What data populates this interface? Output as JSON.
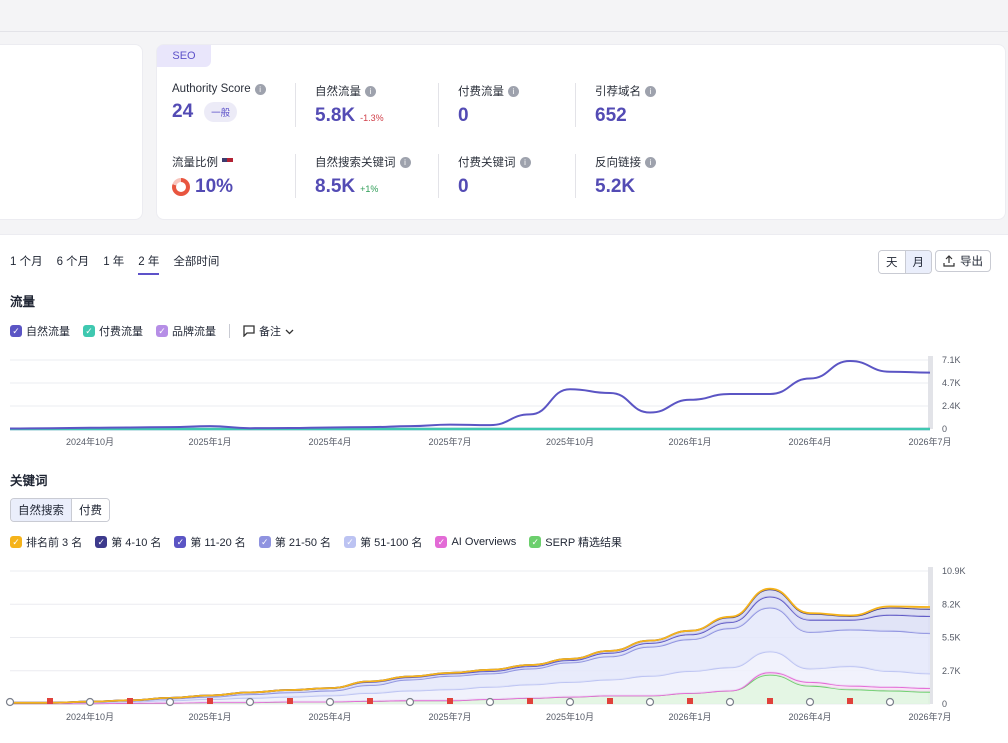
{
  "seo": {
    "tag": "SEO",
    "authority_label": "Authority Score",
    "authority_value": "24",
    "authority_badge": "一般",
    "organic_traffic_label": "自然流量",
    "organic_traffic_value": "5.8K",
    "organic_traffic_change": "-1.3%",
    "paid_traffic_label": "付费流量",
    "paid_traffic_value": "0",
    "ref_domains_label": "引荐域名",
    "ref_domains_value": "652",
    "traffic_share_label": "流量比例",
    "traffic_share_value": "10%",
    "organic_kw_label": "自然搜索关键词",
    "organic_kw_value": "8.5K",
    "organic_kw_change": "+1%",
    "paid_kw_label": "付费关键词",
    "paid_kw_value": "0",
    "backlinks_label": "反向链接",
    "backlinks_value": "5.2K"
  },
  "periods": [
    "1 个月",
    "6 个月",
    "1 年",
    "2 年",
    "全部时间"
  ],
  "active_period": "2 年",
  "granularity": {
    "day": "天",
    "month": "月"
  },
  "export_label": "导出",
  "traffic_title": "流量",
  "traffic_legend": {
    "organic": "自然流量",
    "paid": "付费流量",
    "brand": "品牌流量",
    "notes": "备注"
  },
  "keywords_title": "关键词",
  "kw_tabs": {
    "organic": "自然搜索",
    "paid": "付费"
  },
  "kw_legend": {
    "top3": "排名前 3 名",
    "p4_10": "第 4-10 名",
    "p11_20": "第 11-20 名",
    "p21_50": "第 21-50 名",
    "p51_100": "第 51-100 名",
    "ai": "AI Overviews",
    "serp": "SERP 精选结果"
  },
  "colors": {
    "accent": "#5d52c9",
    "organic": "#5b55c4",
    "paid": "#3fc8b0",
    "brand": "#b68ee6",
    "top3": "#f5b31b",
    "p4_10": "#3d3a8c",
    "p11_20": "#5b55c4",
    "p21_50": "#8f93e0",
    "p51_100": "#bcc3f2",
    "ai": "#e36bd6",
    "serp": "#6ccf6d"
  },
  "chart_data": [
    {
      "type": "area",
      "title": "流量",
      "x": [
        "2024-08",
        "2024-09",
        "2024-10",
        "2024-11",
        "2024-12",
        "2025-01",
        "2025-02",
        "2025-03",
        "2025-04",
        "2025-05",
        "2025-06",
        "2025-07",
        "2025-08",
        "2025-09",
        "2025-10",
        "2025-11",
        "2025-12",
        "2026-01",
        "2026-02",
        "2026-03",
        "2026-04",
        "2026-05",
        "2026-06",
        "2026-07"
      ],
      "x_tick_labels": [
        "2024年10月",
        "2025年1月",
        "2025年4月",
        "2025年7月",
        "2025年10月",
        "2026年1月",
        "2026年4月",
        "2026年7月"
      ],
      "y_ticks": [
        "0",
        "2.4K",
        "4.7K",
        "7.1K"
      ],
      "ylim": [
        0,
        7100
      ],
      "series": [
        {
          "name": "自然流量",
          "values": [
            50,
            80,
            120,
            150,
            200,
            300,
            80,
            100,
            150,
            200,
            300,
            450,
            400,
            1500,
            4100,
            3700,
            1700,
            3000,
            3600,
            3600,
            5200,
            7000,
            5900,
            5800
          ]
        },
        {
          "name": "付费流量",
          "values": [
            0,
            0,
            0,
            0,
            0,
            0,
            0,
            0,
            0,
            0,
            0,
            0,
            0,
            0,
            0,
            0,
            0,
            0,
            0,
            0,
            0,
            0,
            0,
            0
          ]
        },
        {
          "name": "品牌流量",
          "values": [
            0,
            0,
            0,
            0,
            0,
            0,
            0,
            0,
            0,
            0,
            0,
            0,
            0,
            0,
            0,
            0,
            0,
            0,
            0,
            0,
            0,
            0,
            0,
            0
          ]
        }
      ]
    },
    {
      "type": "area",
      "title": "关键词",
      "x": [
        "2024-08",
        "2024-09",
        "2024-10",
        "2024-11",
        "2024-12",
        "2025-01",
        "2025-02",
        "2025-03",
        "2025-04",
        "2025-05",
        "2025-06",
        "2025-07",
        "2025-08",
        "2025-09",
        "2025-10",
        "2025-11",
        "2025-12",
        "2026-01",
        "2026-02",
        "2026-03",
        "2026-04",
        "2026-05",
        "2026-06",
        "2026-07"
      ],
      "x_tick_labels": [
        "2024年10月",
        "2025年1月",
        "2025年4月",
        "2025年7月",
        "2025年10月",
        "2026年1月",
        "2026年4月",
        "2026年7月"
      ],
      "y_ticks": [
        "0",
        "2.7K",
        "5.5K",
        "8.2K",
        "10.9K"
      ],
      "ylim": [
        0,
        10900
      ],
      "stacked": true,
      "series": [
        {
          "name": "SERP 精选结果",
          "values": [
            50,
            50,
            60,
            80,
            100,
            150,
            150,
            200,
            200,
            250,
            300,
            300,
            400,
            500,
            600,
            700,
            700,
            900,
            1100,
            2400,
            1500,
            1200,
            1100,
            1000
          ]
        },
        {
          "name": "AI Overviews",
          "values": [
            0,
            0,
            0,
            0,
            0,
            0,
            0,
            0,
            0,
            0,
            0,
            0,
            0,
            0,
            0,
            0,
            0,
            0,
            0,
            200,
            300,
            300,
            300,
            300
          ]
        },
        {
          "name": "第 51-100 名",
          "values": [
            50,
            50,
            80,
            120,
            200,
            250,
            350,
            400,
            500,
            650,
            800,
            900,
            1000,
            1100,
            1200,
            1300,
            1600,
            1800,
            1900,
            1700,
            1100,
            1600,
            1300,
            1200
          ]
        },
        {
          "name": "第 21-50 名",
          "values": [
            0,
            0,
            50,
            80,
            150,
            200,
            300,
            350,
            400,
            650,
            900,
            1100,
            1100,
            1300,
            1600,
            1900,
            2400,
            2600,
            3200,
            3600,
            3000,
            3000,
            3300,
            3300
          ]
        },
        {
          "name": "第 11-20 名",
          "values": [
            0,
            0,
            0,
            20,
            50,
            100,
            150,
            200,
            200,
            250,
            200,
            200,
            200,
            200,
            200,
            300,
            300,
            400,
            500,
            900,
            1000,
            800,
            1300,
            1400
          ]
        },
        {
          "name": "第 4-10 名",
          "values": [
            0,
            0,
            0,
            0,
            0,
            0,
            0,
            0,
            0,
            50,
            50,
            50,
            100,
            100,
            100,
            150,
            200,
            300,
            400,
            600,
            500,
            300,
            600,
            600
          ]
        },
        {
          "name": "排名前 3 名",
          "values": [
            0,
            0,
            0,
            0,
            0,
            0,
            0,
            0,
            0,
            0,
            0,
            0,
            0,
            0,
            0,
            0,
            0,
            0,
            50,
            50,
            50,
            50,
            100,
            150
          ]
        }
      ]
    }
  ]
}
